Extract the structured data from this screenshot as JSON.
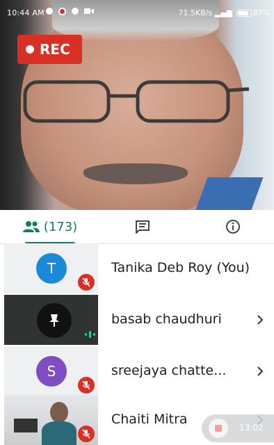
{
  "status_bar": {
    "time": "10:44 AM",
    "network_speed": "71.5KB/s",
    "battery": "87%"
  },
  "recording_badge": {
    "label": "REC"
  },
  "tabs": {
    "people_count": "(173)"
  },
  "participants": [
    {
      "initial": "T",
      "name": "Tanika Deb Roy (You)",
      "avatar_color": "#1a8ad8",
      "muted": true
    },
    {
      "name": "basab chaudhuri",
      "pinned": true,
      "speaking": true
    },
    {
      "initial": "S",
      "name": "sreejaya chatte...",
      "avatar_color": "#7e4dc1",
      "muted": true
    },
    {
      "name": "Chaiti Mitra",
      "muted": true
    }
  ],
  "recording_timer": {
    "time": "13:02"
  },
  "colors": {
    "accent_green": "#137a5b",
    "mute_red": "#d93025"
  }
}
